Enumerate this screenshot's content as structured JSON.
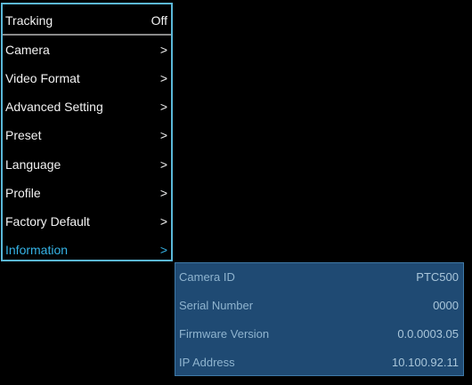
{
  "menu": {
    "items": [
      {
        "label": "Tracking",
        "value": "Off"
      },
      {
        "label": "Camera",
        "value": ">"
      },
      {
        "label": "Video Format",
        "value": ">"
      },
      {
        "label": "Advanced Setting",
        "value": ">"
      },
      {
        "label": "Preset",
        "value": ">"
      },
      {
        "label": "Language",
        "value": ">"
      },
      {
        "label": "Profile",
        "value": ">"
      },
      {
        "label": "Factory Default",
        "value": ">"
      },
      {
        "label": "Information",
        "value": ">"
      }
    ],
    "selected_index": 8,
    "border_color": "#5bb8d9",
    "selected_color": "#35b3e6"
  },
  "info": {
    "rows": [
      {
        "label": "Camera ID",
        "value": "PTC500"
      },
      {
        "label": "Serial Number",
        "value": "0000"
      },
      {
        "label": "Firmware Version",
        "value": "0.0.0003.05"
      },
      {
        "label": "IP Address",
        "value": "10.100.92.11"
      }
    ],
    "background_color": "#1f4a73"
  }
}
